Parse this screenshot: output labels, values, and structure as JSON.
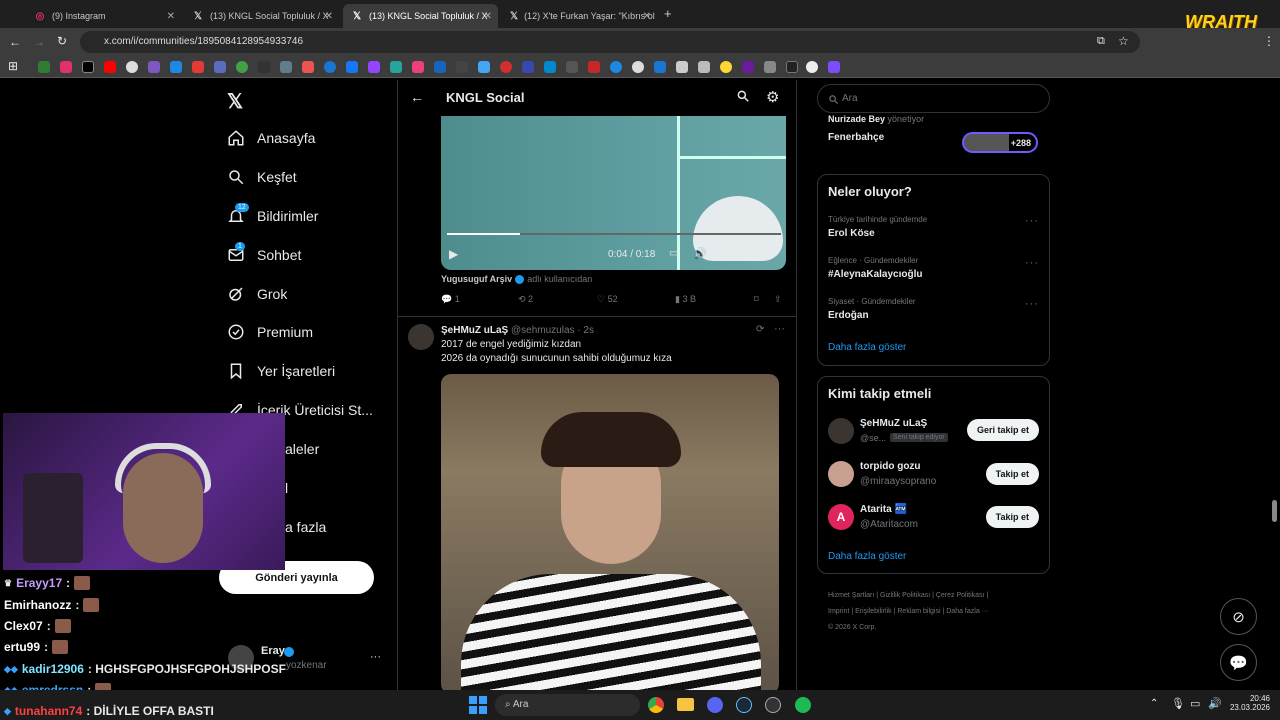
{
  "tabs": [
    {
      "label": "(9) Instagram",
      "icon": "instagram-icon"
    },
    {
      "label": "(13) KNGL Social Topluluk / X",
      "icon": "x-logo-icon"
    },
    {
      "label": "(13) KNGL Social Topluluk / X",
      "icon": "x-logo-icon"
    },
    {
      "label": "(12) X'te Furkan Yaşar: \"Kıbrıs ol",
      "icon": "x-logo-icon"
    }
  ],
  "url": "x.com/i/communities/1895084128954933746",
  "stream_logo": "WRAITH",
  "nav": {
    "items": [
      {
        "label": "Anasayfa",
        "icon": "home-icon"
      },
      {
        "label": "Keşfet",
        "icon": "search-icon"
      },
      {
        "label": "Bildirimler",
        "icon": "bell-icon",
        "badge": "12"
      },
      {
        "label": "Sohbet",
        "icon": "mail-icon",
        "badge": "1"
      },
      {
        "label": "Grok",
        "icon": "grok-icon"
      },
      {
        "label": "Premium",
        "icon": "premium-icon"
      },
      {
        "label": "Yer İşaretleri",
        "icon": "bookmark-icon"
      },
      {
        "label": "İçerik Üreticisi St...",
        "icon": "rocket-icon"
      },
      {
        "label": "aleler",
        "icon": "article-icon"
      },
      {
        "label": "l",
        "icon": "profile-icon"
      },
      {
        "label": "a fazla",
        "icon": "more-icon"
      }
    ],
    "post_button": "Gönderi yayınla",
    "account": {
      "name": "Eray",
      "handle": "yozkenar",
      "more": "···"
    }
  },
  "header": {
    "title": "KNGL Social"
  },
  "video": {
    "time": "0:04 / 0:18",
    "progress": 0.22
  },
  "post1": {
    "author": "Yugusuguf Arşiv",
    "author_note": "adlı kullanıcıdan",
    "replies": "1",
    "reposts": "2",
    "likes": "52",
    "views": "3 B"
  },
  "post2": {
    "name": "ŞeHMuZ uLaŞ",
    "handle": "@sehmuzulas",
    "time": "· 2s",
    "text1": "2017 de engel yediğimiz kızdan",
    "text2": "2026 da oynadığı sunucunun sahibi olduğumuz kıza"
  },
  "search": {
    "placeholder": "Ara"
  },
  "community": {
    "admin": "Nurizade Bey",
    "admin_role": "yönetiyor",
    "name": "Fenerbahçe",
    "members": "+288"
  },
  "trends": {
    "title": "Neler oluyor?",
    "items": [
      {
        "cat": "Türkiye tarihinde gündemde",
        "name": "Erol Köse"
      },
      {
        "cat": "Eğlence · Gündemdekiler",
        "name": "#AleynaKalaycıoğlu"
      },
      {
        "cat": "Siyaset · Gündemdekiler",
        "name": "Erdoğan"
      }
    ],
    "more": "Daha fazla göster"
  },
  "who": {
    "title": "Kimi takip etmeli",
    "items": [
      {
        "name": "ŞeHMuZ uLaŞ",
        "handle": "@se...",
        "note": "Seni takip ediyor",
        "btn": "Geri takip et"
      },
      {
        "name": "torpido gozu",
        "handle": "@miraaysoprano",
        "btn": "Takip et"
      },
      {
        "name": "Atarita 🏧",
        "handle": "@Ataritacom",
        "btn": "Takip et"
      }
    ],
    "more": "Daha fazla göster"
  },
  "footer": {
    "l1": "Hizmet Şartları | Gizlilik Politikası | Çerez Politikası |",
    "l2": "Imprint | Erişilebilirlik | Reklam bilgisi | Daha fazla ···",
    "l3": "© 2026 X Corp."
  },
  "chat": [
    {
      "user": "Erayy17",
      "msg": ":",
      "color": "#c79bff"
    },
    {
      "user": "Emirhanozz",
      "msg": ":",
      "color": "#ffffff"
    },
    {
      "user": "Clex07",
      "msg": ":",
      "color": "#ffffff"
    },
    {
      "user": "ertu99",
      "msg": ":",
      "color": "#ffffff"
    },
    {
      "user": "kadir12906",
      "msg": ": HGHSFGPOJHSFGPOHJSHPOSF",
      "color": "#7fe6ff"
    },
    {
      "user": "emredrssn",
      "msg": ":",
      "color": "#3aa0ff"
    },
    {
      "user": "tunahann74",
      "msg": ": DİLİYLE OFFA BASTI",
      "color": "#ff4040"
    }
  ],
  "taskbar": {
    "search": "Ara",
    "time": "20:46",
    "date": "23.03.2026"
  },
  "colors": {
    "accent": "#1d9bf0",
    "bg": "#000000",
    "border": "#2f3336"
  }
}
